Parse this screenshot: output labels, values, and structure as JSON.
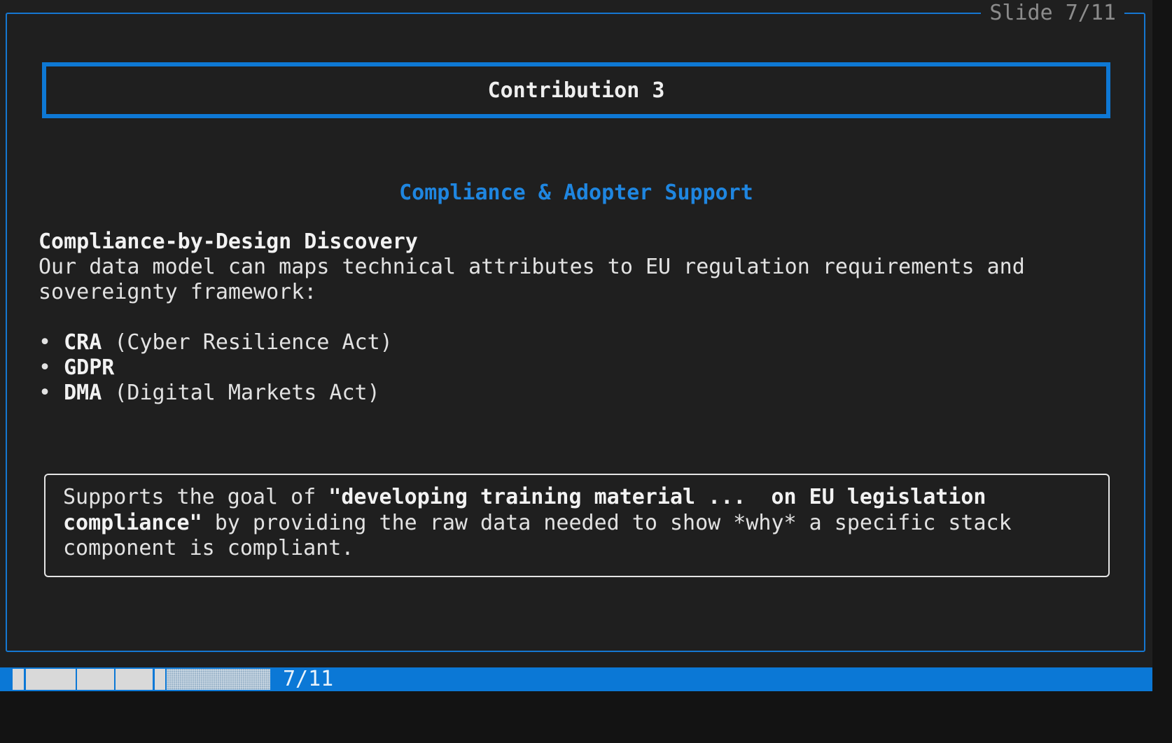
{
  "slide_counter": "Slide 7/11",
  "title": "Contribution 3",
  "subtitle": "Compliance & Adopter Support",
  "section": {
    "heading": "Compliance-by-Design Discovery",
    "text_line1": "Our data model can maps technical attributes to EU regulation requirements and",
    "text_line2": "sovereignty framework:"
  },
  "bullets": [
    {
      "marker": "• ",
      "term": "CRA",
      "rest": " (Cyber Resilience Act)"
    },
    {
      "marker": "• ",
      "term": "GDPR",
      "rest": ""
    },
    {
      "marker": "• ",
      "term": "DMA",
      "rest": " (Digital Markets Act)"
    }
  ],
  "note": {
    "l1_plain": "Supports the goal of ",
    "l1_bold": "\"developing training material ...  on EU legislation",
    "l2_bold": "compliance\"",
    "l2_plain": " by providing the raw data needed to show *why* a specific stack",
    "l3_plain": "component is compliant."
  },
  "status": {
    "page": "7/11",
    "progress_current": 7,
    "progress_total": 11
  },
  "colors": {
    "accent": "#0e78d4",
    "background": "#1f1f1f",
    "status_bar": "#0b78d6"
  }
}
